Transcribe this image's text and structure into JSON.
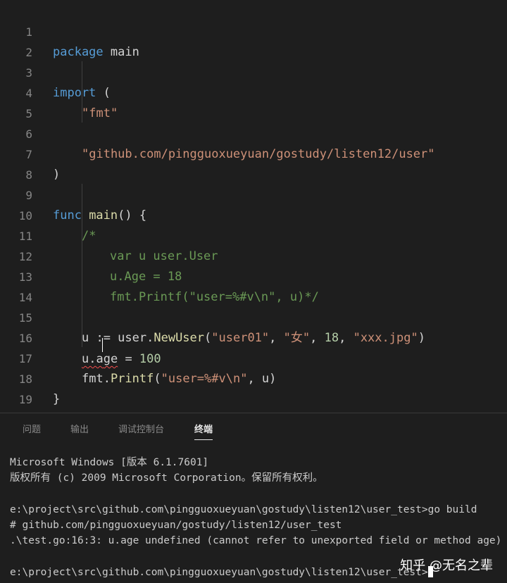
{
  "editor": {
    "line_numbers": [
      "1",
      "2",
      "3",
      "4",
      "5",
      "6",
      "7",
      "8",
      "9",
      "10",
      "11",
      "12",
      "13",
      "14",
      "15",
      "16",
      "17",
      "18",
      "19"
    ],
    "l1": {
      "kw": "package",
      "name": " main"
    },
    "l3": {
      "kw": "import",
      "paren": " ("
    },
    "l4": {
      "str": "\"fmt\""
    },
    "l6": {
      "str": "\"github.com/pingguoxueyuan/gostudy/listen12/user\""
    },
    "l7": {
      "paren": ")"
    },
    "l9": {
      "kw": "func",
      "fn": " main",
      "rest": "() {"
    },
    "l10": {
      "cmt": "/*"
    },
    "l11": {
      "cmt": "var u user.User"
    },
    "l12": {
      "cmt": "u.Age = 18"
    },
    "l13": {
      "cmt": "fmt.Printf(\"user=%#v\\n\", u)*/"
    },
    "l15": {
      "a": "u := user.",
      "fn": "NewUser",
      "b": "(",
      "s1": "\"user01\"",
      "c1": ", ",
      "s2": "\"女\"",
      "c2": ", ",
      "n": "18",
      "c3": ", ",
      "s3": "\"xxx.jpg\"",
      "d": ")"
    },
    "l16": {
      "a1": "u.a",
      "a2": "ge",
      "b": " = ",
      "n": "100"
    },
    "l17": {
      "a": "fmt.",
      "fn": "Printf",
      "b": "(",
      "s": "\"user=%#v\\n\"",
      "c": ", u)"
    },
    "l18": {
      "brace": "}"
    }
  },
  "panel": {
    "tabs": [
      {
        "label": "问题"
      },
      {
        "label": "输出"
      },
      {
        "label": "调试控制台"
      },
      {
        "label": "终端"
      }
    ],
    "terminal": {
      "lines": [
        "Microsoft Windows [版本 6.1.7601]",
        "版权所有 (c) 2009 Microsoft Corporation。保留所有权利。",
        "e:\\project\\src\\github.com\\pingguoxueyuan\\gostudy\\listen12\\user_test>go build",
        "# github.com/pingguoxueyuan/gostudy/listen12/user_test",
        ".\\test.go:16:3: u.age undefined (cannot refer to unexported field or method age)",
        "e:\\project\\src\\github.com\\pingguoxueyuan\\gostudy\\listen12\\user_test>"
      ]
    }
  },
  "watermark": {
    "text": "知乎 @无名之辈"
  },
  "colors": {
    "background": "#1e1e1e",
    "keyword": "#569cd6",
    "string": "#ce9178",
    "function": "#dcdcaa",
    "comment": "#6a9955",
    "number": "#b5cea8",
    "error_squiggle": "#f14c4c"
  }
}
